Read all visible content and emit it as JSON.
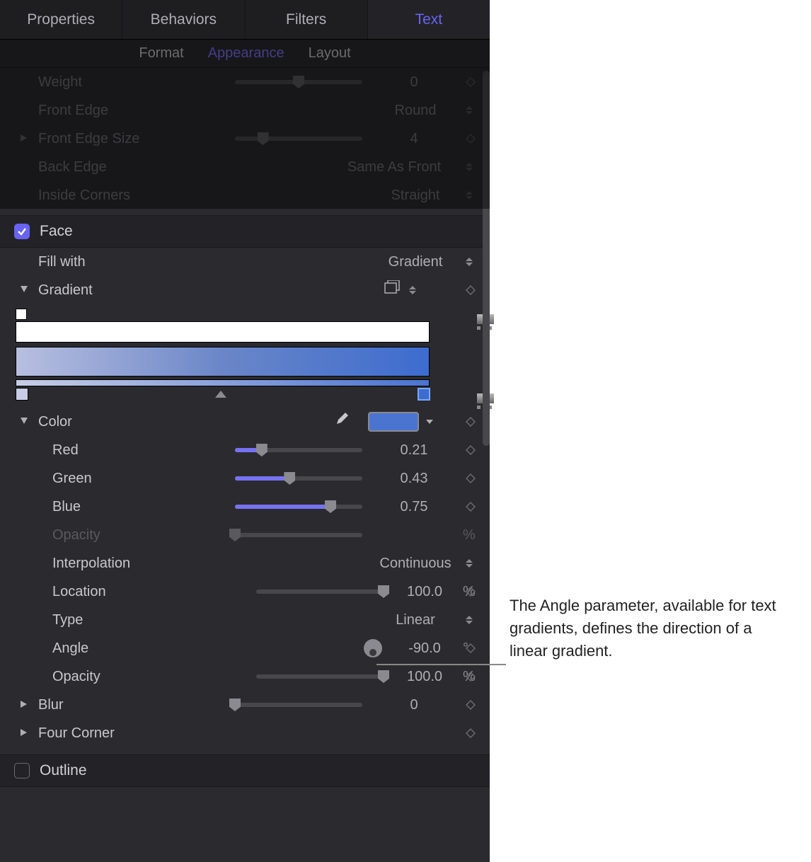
{
  "tabs": {
    "properties": "Properties",
    "behaviors": "Behaviors",
    "filters": "Filters",
    "text": "Text"
  },
  "subtabs": {
    "format": "Format",
    "appearance": "Appearance",
    "layout": "Layout"
  },
  "params": {
    "weight": {
      "label": "Weight",
      "value": "0"
    },
    "front_edge": {
      "label": "Front Edge",
      "value": "Round"
    },
    "front_edge_size": {
      "label": "Front Edge Size",
      "value": "4"
    },
    "back_edge": {
      "label": "Back Edge",
      "value": "Same As Front"
    },
    "inside_corners": {
      "label": "Inside Corners",
      "value": "Straight"
    },
    "face": {
      "label": "Face"
    },
    "fill_with": {
      "label": "Fill with",
      "value": "Gradient"
    },
    "gradient": {
      "label": "Gradient"
    },
    "color": {
      "label": "Color",
      "swatch": "#4a74d0"
    },
    "red": {
      "label": "Red",
      "value": "0.21",
      "pct": 21
    },
    "green": {
      "label": "Green",
      "value": "0.43",
      "pct": 43
    },
    "blue": {
      "label": "Blue",
      "value": "0.75",
      "pct": 75
    },
    "opacity_rgba": {
      "label": "Opacity",
      "unit": "%"
    },
    "interpolation": {
      "label": "Interpolation",
      "value": "Continuous"
    },
    "location": {
      "label": "Location",
      "value": "100.0",
      "unit": "%",
      "pct": 100
    },
    "type": {
      "label": "Type",
      "value": "Linear"
    },
    "angle": {
      "label": "Angle",
      "value": "-90.0",
      "unit": "°"
    },
    "opacity": {
      "label": "Opacity",
      "value": "100.0",
      "unit": "%",
      "pct": 100
    },
    "blur": {
      "label": "Blur",
      "value": "0",
      "pct": 0
    },
    "four_corner": {
      "label": "Four Corner"
    },
    "outline": {
      "label": "Outline"
    }
  },
  "annotation": "The Angle parameter, available for text gradients, defines the direction of a linear gradient."
}
